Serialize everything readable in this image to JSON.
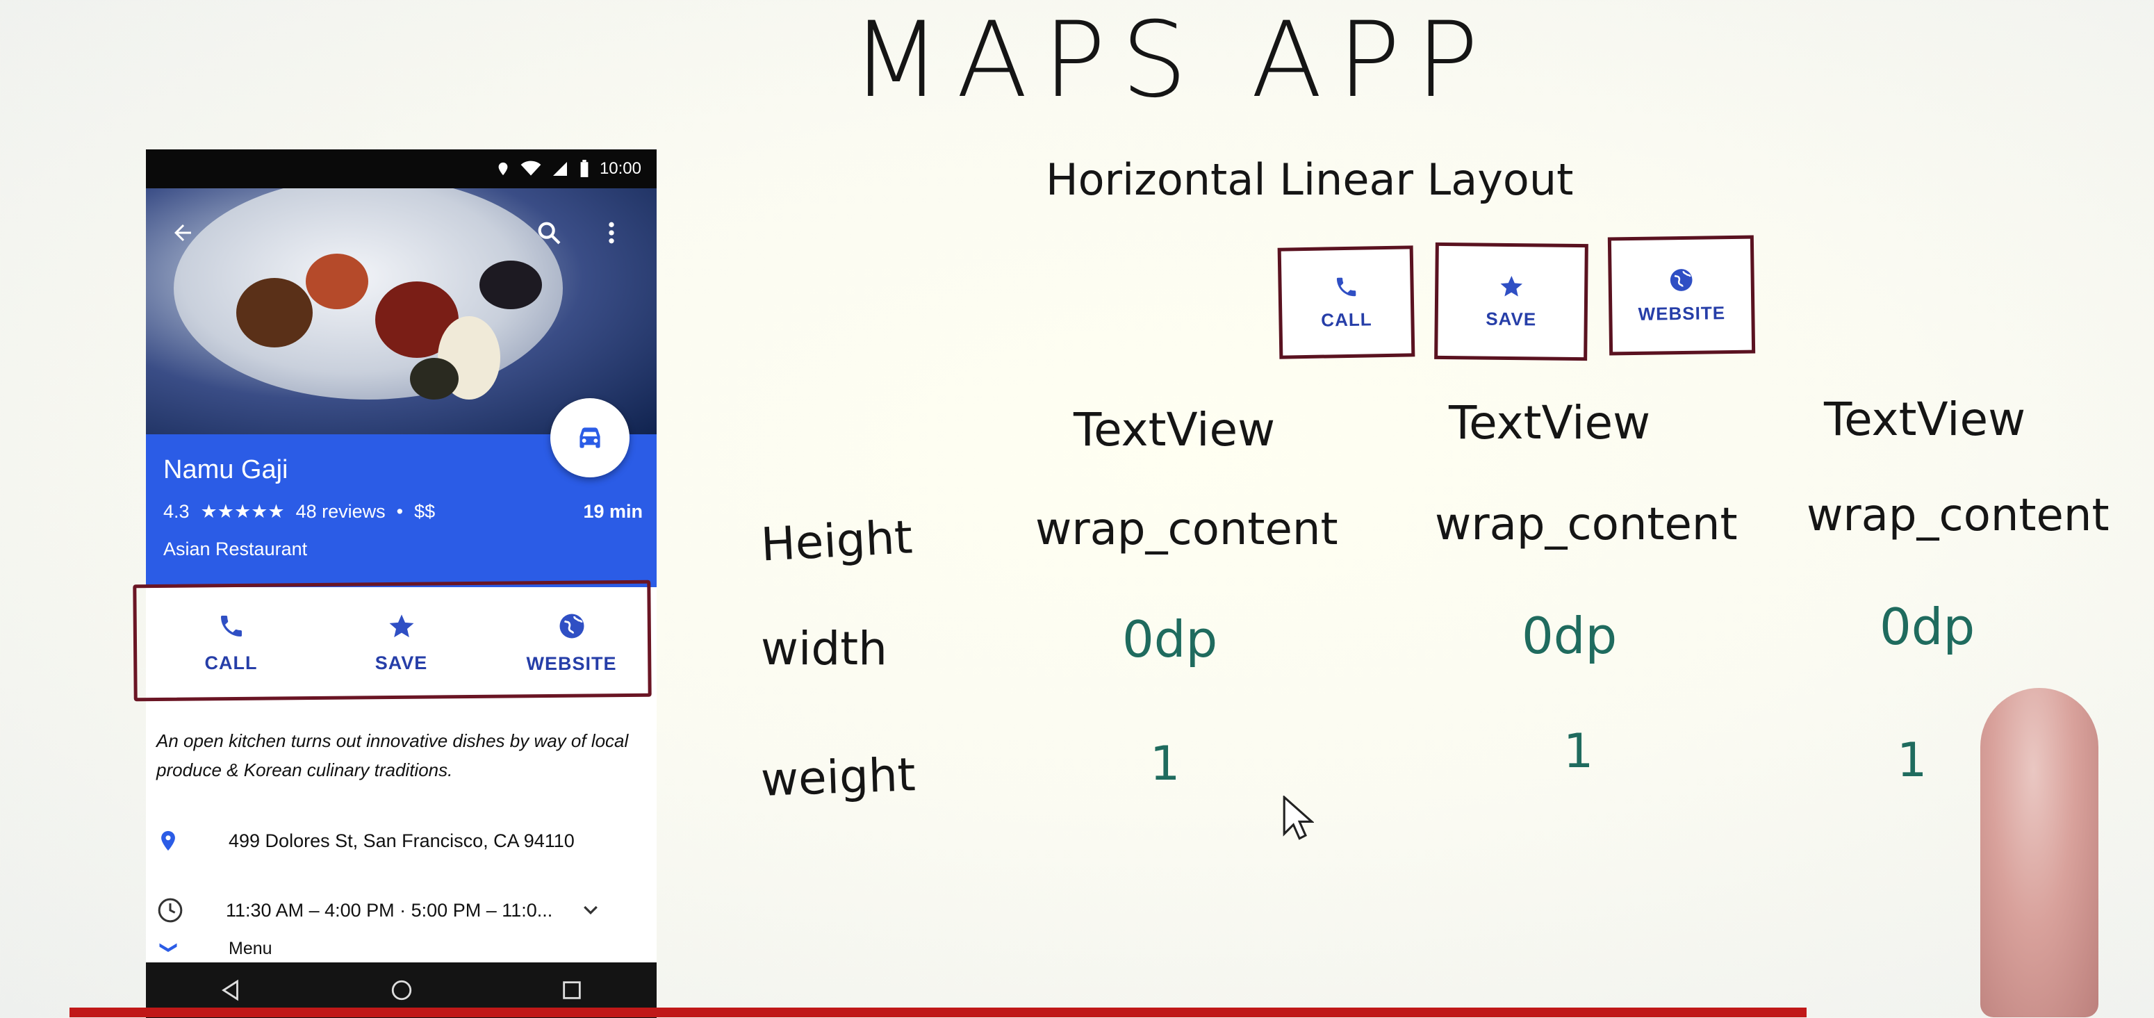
{
  "board": {
    "title": "MAPS APP",
    "subtitle": "Horizontal Linear Layout",
    "row_labels": {
      "height": "Height",
      "width": "width",
      "weight": "weight"
    },
    "columns": [
      {
        "view": "TextView",
        "height": "wrap_content",
        "width": "0dp",
        "weight": "1"
      },
      {
        "view": "TextView",
        "height": "wrap_content",
        "width": "0dp",
        "weight": "1"
      },
      {
        "view": "TextView",
        "height": "wrap_content",
        "width": "0dp",
        "weight": "1"
      }
    ],
    "boxes": [
      {
        "label": "CALL",
        "icon": "phone-icon"
      },
      {
        "label": "SAVE",
        "icon": "star-icon"
      },
      {
        "label": "WEBSITE",
        "icon": "globe-icon"
      }
    ],
    "line_color": "#5a1220",
    "green_ink": "#1f6b5e"
  },
  "phone": {
    "status_time": "10:00",
    "place_name": "Namu Gaji",
    "rating": "4.3",
    "stars": "★★★★★",
    "reviews": "48 reviews",
    "separator": "•",
    "price": "$$",
    "drive_time": "19 min",
    "category": "Asian Restaurant",
    "actions": [
      {
        "label": "CALL",
        "icon": "phone-icon"
      },
      {
        "label": "SAVE",
        "icon": "star-icon"
      },
      {
        "label": "WEBSITE",
        "icon": "globe-icon"
      }
    ],
    "description": "An open kitchen turns out innovative dishes by way of local produce & Korean culinary traditions.",
    "address": "499 Dolores St, San Francisco, CA 94110",
    "hours": "11:30 AM – 4:00 PM · 5:00 PM – 11:0...",
    "menu": "Menu",
    "accent": "#2b5ce6",
    "icon_blue": "#263ea8"
  }
}
